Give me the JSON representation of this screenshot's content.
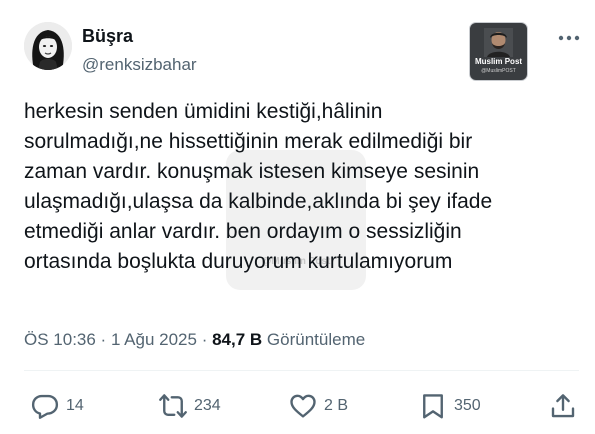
{
  "author": {
    "display_name": "Büşra",
    "handle": "@renksizbahar"
  },
  "watermark": {
    "title": "Muslim Post",
    "handle": "@MuslimPOST",
    "center_text": "@Muslim Post"
  },
  "tweet": {
    "lines": [
      "herkesin senden ümidini kestiği,hâlinin",
      "sorulmadığı,ne hissettiğinin merak edilmediği bir",
      "zaman vardır. konuşmak istesen kimseye sesinin",
      "ulaşmadığı,ulaşsa da kalbinde,aklında bi şey ifade",
      "etmediği anlar vardır. ben ordayım o sessizliğin",
      "ortasında boşlukta duruyorum kurtulamıyorum"
    ]
  },
  "meta": {
    "time": "ÖS 10:36",
    "separator": " · ",
    "date": "1 Ağu 2025",
    "views_count": "84,7 B",
    "views_label": "Görüntüleme"
  },
  "actions": {
    "replies": "14",
    "reposts": "234",
    "likes": "2 B",
    "bookmarks": "350"
  },
  "icons": {
    "reply": "reply-icon",
    "repost": "repost-icon",
    "like": "heart-icon",
    "bookmark": "bookmark-icon",
    "share": "share-icon",
    "more": "more-icon"
  },
  "colors": {
    "text": "#0f1419",
    "secondary": "#536471",
    "divider": "#eff3f4"
  }
}
